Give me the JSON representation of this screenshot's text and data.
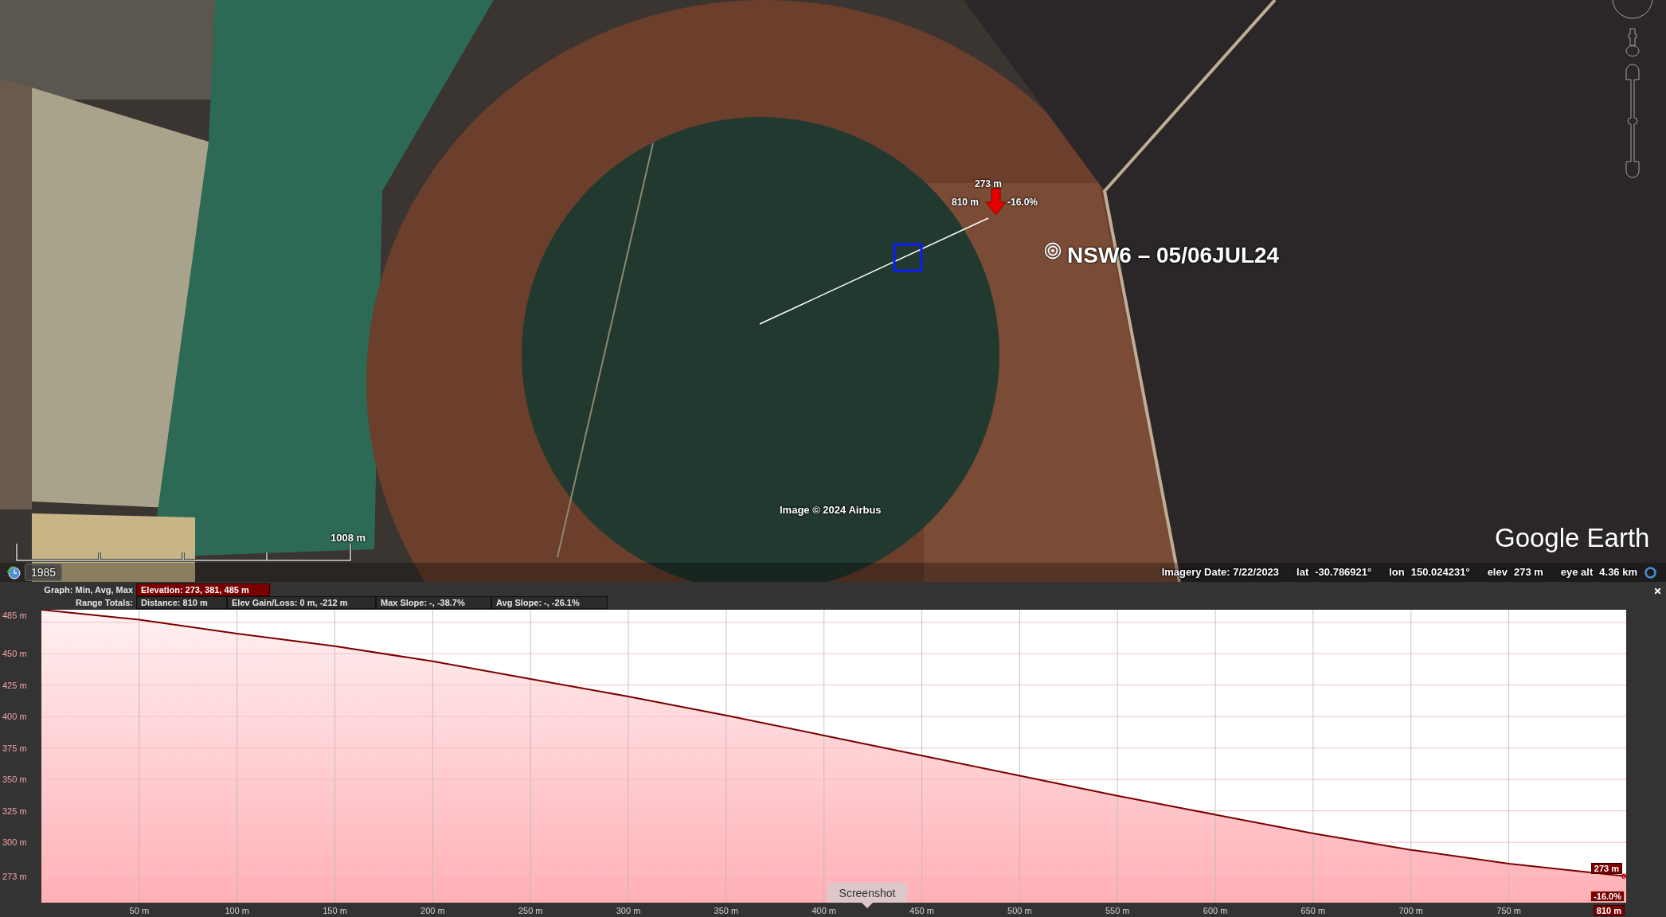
{
  "map": {
    "measurement": {
      "elevation": "273 m",
      "distance": "810 m",
      "slope": "-16.0%"
    },
    "placemark": {
      "label": "NSW6 – 05/06JUL24"
    },
    "attribution": "Image © 2024 Airbus",
    "logo": "Google Earth",
    "scale_bar": {
      "label": "1008 m"
    },
    "historical_imagery": {
      "year": "1985"
    }
  },
  "status_bar": {
    "imagery_date": "Imagery Date: 7/22/2023",
    "fields": [
      {
        "label": "lat",
        "value": "-30.786921°"
      },
      {
        "label": "lon",
        "value": "150.024231°"
      },
      {
        "label": "elev",
        "value": "273 m"
      },
      {
        "label": "eye alt",
        "value": "4.36 km"
      }
    ]
  },
  "elevation_profile": {
    "graph": {
      "label": "Graph: Min, Avg, Max",
      "value": "Elevation: 273, 381, 485 m"
    },
    "range_totals": {
      "label": "Range Totals:",
      "items": [
        "Distance: 810 m",
        "Elev Gain/Loss: 0 m, -212 m",
        "Max Slope: -, -38.7%",
        "Avg Slope: -, -26.1%"
      ]
    },
    "chart_data": {
      "type": "area",
      "grid": true,
      "x": [
        0,
        50,
        100,
        150,
        200,
        250,
        300,
        350,
        400,
        450,
        500,
        550,
        600,
        650,
        700,
        750,
        810
      ],
      "series": [
        {
          "color": "#7a0000",
          "values": [
            485,
            477,
            466,
            456,
            444,
            430,
            416,
            401,
            385,
            369,
            353,
            337,
            322,
            307,
            294,
            283,
            273
          ]
        }
      ],
      "xlim": [
        0,
        810
      ],
      "ylim": [
        252,
        485
      ],
      "xticks": [
        {
          "value": 50,
          "label": "50 m"
        },
        {
          "value": 100,
          "label": "100 m"
        },
        {
          "value": 150,
          "label": "150 m"
        },
        {
          "value": 200,
          "label": "200 m"
        },
        {
          "value": 250,
          "label": "250 m"
        },
        {
          "value": 300,
          "label": "300 m"
        },
        {
          "value": 350,
          "label": "350 m"
        },
        {
          "value": 400,
          "label": "400 m"
        },
        {
          "value": 450,
          "label": "450 m"
        },
        {
          "value": 500,
          "label": "500 m"
        },
        {
          "value": 550,
          "label": "550 m"
        },
        {
          "value": 600,
          "label": "600 m"
        },
        {
          "value": 650,
          "label": "650 m"
        },
        {
          "value": 700,
          "label": "700 m"
        },
        {
          "value": 750,
          "label": "750 m"
        }
      ],
      "yticks": [
        {
          "value": 485,
          "label": "485 m"
        },
        {
          "value": 450,
          "label": "450 m"
        },
        {
          "value": 425,
          "label": "425 m"
        },
        {
          "value": 400,
          "label": "400 m"
        },
        {
          "value": 375,
          "label": "375 m"
        },
        {
          "value": 350,
          "label": "350 m"
        },
        {
          "value": 325,
          "label": "325 m"
        },
        {
          "value": 300,
          "label": "300 m"
        },
        {
          "value": 273,
          "label": "273 m"
        }
      ]
    },
    "cursor": {
      "elevation": "273 m",
      "slope": "-16.0%",
      "distance": "810 m"
    }
  },
  "tooltip": {
    "text": "Screenshot"
  }
}
